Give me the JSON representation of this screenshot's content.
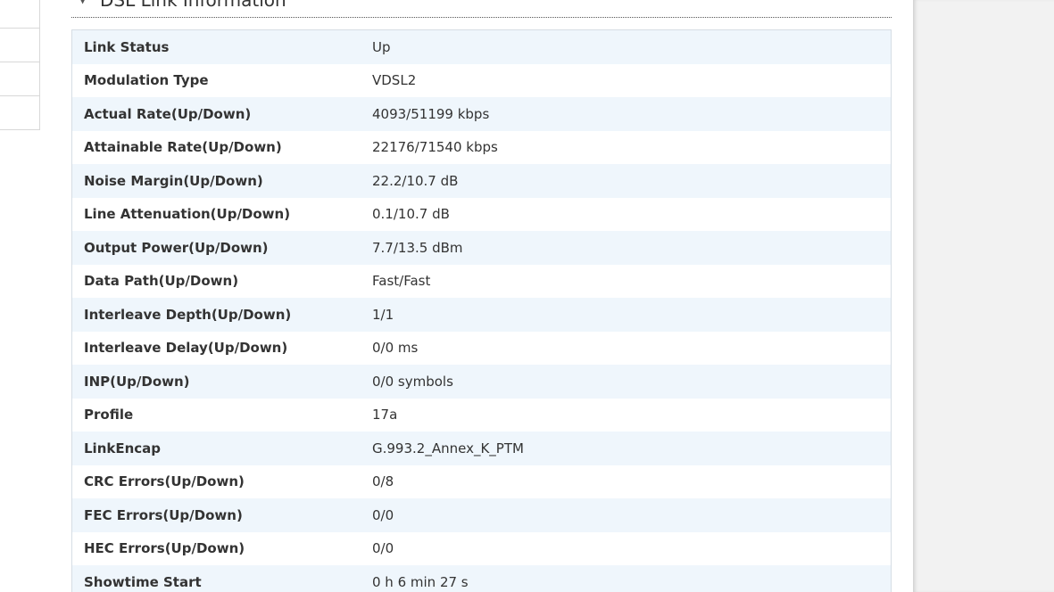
{
  "section": {
    "title": "DSL Link Information",
    "toggle_icon": "triangle-down-icon"
  },
  "rows": [
    {
      "label": "Link Status",
      "value": "Up"
    },
    {
      "label": "Modulation Type",
      "value": "VDSL2"
    },
    {
      "label": "Actual Rate(Up/Down)",
      "value": "4093/51199 kbps"
    },
    {
      "label": "Attainable Rate(Up/Down)",
      "value": "22176/71540 kbps"
    },
    {
      "label": "Noise Margin(Up/Down)",
      "value": "22.2/10.7 dB"
    },
    {
      "label": "Line Attenuation(Up/Down)",
      "value": "0.1/10.7 dB"
    },
    {
      "label": "Output Power(Up/Down)",
      "value": "7.7/13.5 dBm"
    },
    {
      "label": "Data Path(Up/Down)",
      "value": "Fast/Fast"
    },
    {
      "label": "Interleave Depth(Up/Down)",
      "value": "1/1"
    },
    {
      "label": "Interleave Delay(Up/Down)",
      "value": "0/0 ms"
    },
    {
      "label": "INP(Up/Down)",
      "value": "0/0 symbols"
    },
    {
      "label": "Profile",
      "value": "17a"
    },
    {
      "label": "LinkEncap",
      "value": "G.993.2_Annex_K_PTM"
    },
    {
      "label": "CRC Errors(Up/Down)",
      "value": "0/8"
    },
    {
      "label": "FEC Errors(Up/Down)",
      "value": "0/0"
    },
    {
      "label": "HEC Errors(Up/Down)",
      "value": "0/0"
    },
    {
      "label": "Showtime Start",
      "value": "0 h 6 min 27 s"
    }
  ]
}
